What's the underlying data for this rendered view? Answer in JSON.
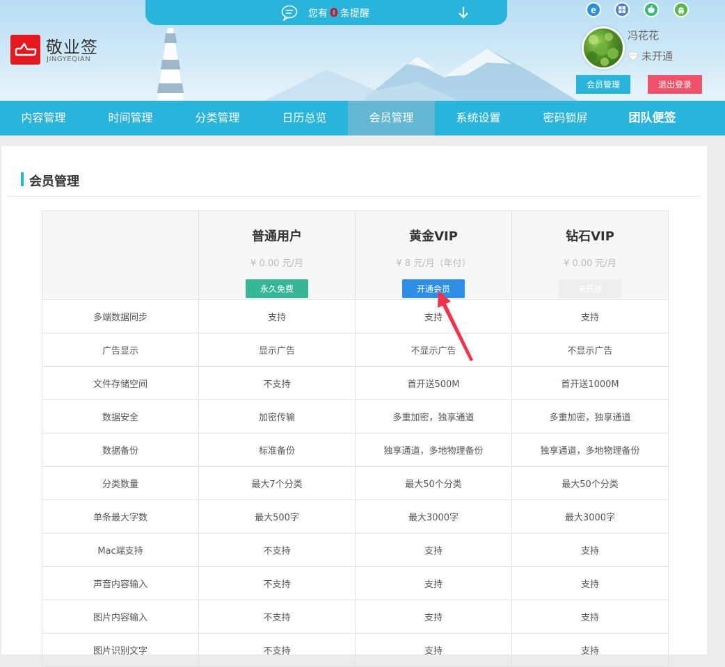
{
  "notice": {
    "prefix": "您有",
    "count": "0",
    "suffix": "条提醒"
  },
  "logo": {
    "title": "敬业签",
    "subtitle": "JINGYEQIAN"
  },
  "platforms": [
    "ie-icon",
    "windows-icon",
    "apple-icon",
    "android-icon"
  ],
  "user": {
    "name": "冯花花",
    "vip_status": "未开通",
    "member_button": "会员管理",
    "logout_button": "退出登录"
  },
  "nav": {
    "items": [
      {
        "label": "内容管理"
      },
      {
        "label": "时间管理"
      },
      {
        "label": "分类管理"
      },
      {
        "label": "日历总览"
      },
      {
        "label": "会员管理"
      },
      {
        "label": "系统设置"
      },
      {
        "label": "密码锁屏"
      },
      {
        "label": "团队便签"
      }
    ],
    "active_index": 4
  },
  "section": {
    "title": "会员管理"
  },
  "plans": [
    {
      "name": "普通用户",
      "price": "¥ 0.00 元/月",
      "button": "永久免费",
      "button_color": "#35b795"
    },
    {
      "name": "黄金VIP",
      "price": "¥ 8 元/月（年付）",
      "button": "开通会员",
      "button_color": "#2f8fe6"
    },
    {
      "name": "钻石VIP",
      "price": "¥ 0.00 元/月",
      "button": "未开放",
      "button_color": "#eeeeee"
    }
  ],
  "features": [
    {
      "name": "多端数据同步",
      "values": [
        "支持",
        "支持",
        "支持"
      ]
    },
    {
      "name": "广告显示",
      "values": [
        "显示广告",
        "不显示广告",
        "不显示广告"
      ]
    },
    {
      "name": "文件存储空间",
      "values": [
        "不支持",
        "首开送500M",
        "首开送1000M"
      ]
    },
    {
      "name": "数据安全",
      "values": [
        "加密传输",
        "多重加密，独享通道",
        "多重加密，独享通道"
      ]
    },
    {
      "name": "数据备份",
      "values": [
        "标准备份",
        "独享通道，多地物理备份",
        "独享通道，多地物理备份"
      ]
    },
    {
      "name": "分类数量",
      "values": [
        "最大7个分类",
        "最大50个分类",
        "最大50个分类"
      ]
    },
    {
      "name": "单条最大字数",
      "values": [
        "最大500字",
        "最大3000字",
        "最大3000字"
      ]
    },
    {
      "name": "Mac端支持",
      "values": [
        "不支持",
        "支持",
        "支持"
      ]
    },
    {
      "name": "声音内容输入",
      "values": [
        "不支持",
        "支持",
        "支持"
      ]
    },
    {
      "name": "图片内容输入",
      "values": [
        "不支持",
        "支持",
        "支持"
      ]
    },
    {
      "name": "图片识别文字",
      "values": [
        "不支持",
        "支持",
        "支持"
      ]
    }
  ],
  "colors": {
    "accent": "#29b4dc",
    "logout": "#f0516a",
    "logo_red": "#e5171f",
    "annotation_arrow": "#f0324a"
  }
}
